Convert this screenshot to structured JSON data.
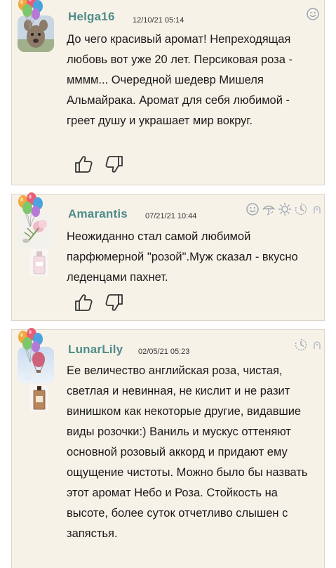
{
  "reviews": [
    {
      "username": "Helga16",
      "date": "12/10/21 05:14",
      "text": "До чего красивый аромат! Непреходящая любовь вот уже 20 лет. Персиковая роза - мммм... Очередной шедевр Мишеля Альмайрака. Аромат для себя любимой - греет душу и украшает мир вокруг.",
      "icons": [
        "smile-icon"
      ]
    },
    {
      "username": "Amarantis",
      "date": "07/21/21 10:44",
      "text": "Неожиданно стал самой любимой парфюмерной \"розой\".Муж сказал - вкусно леденцами пахнет.",
      "icons": [
        "smile-icon",
        "umbrella-icon",
        "sun-icon",
        "clock-icon",
        "moon-icon"
      ]
    },
    {
      "username": "LunarLily",
      "date": "02/05/21 05:23",
      "text": "Ее величество английская роза, чистая, светлая и невинная, не кислит и не разит винишком как некоторые другие, видавшие виды розочки:) Ваниль и мускус оттеняют основной розовый аккорд и придают ему ощущение чистоты. Можно было бы назвать этот аромат Небо и Роза. Стойкость на высоте, более суток отчетливо слышен с запястья.",
      "icons": [
        "clock-icon",
        "moon-icon"
      ]
    }
  ],
  "colors": {
    "card_bg": "#f7f2e8",
    "card_border": "#ddd6c8",
    "username": "#4f8c8a",
    "icon": "#9aa6b3"
  }
}
